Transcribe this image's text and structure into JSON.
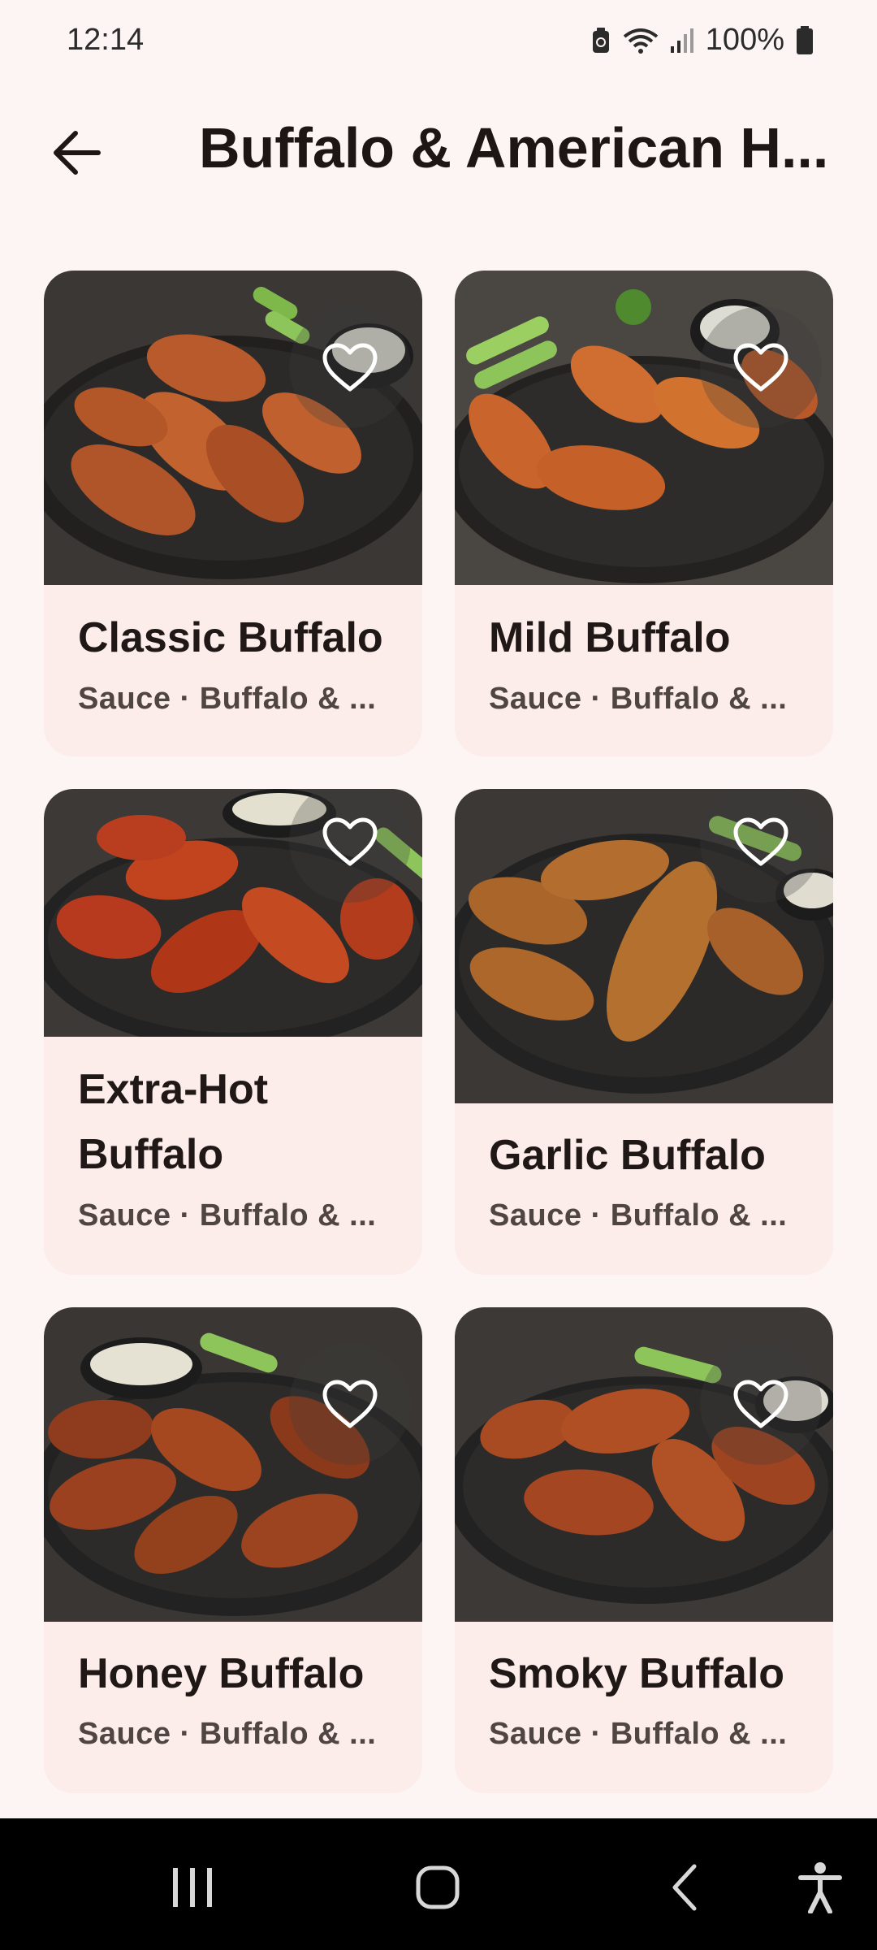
{
  "status": {
    "time": "12:14",
    "battery": "100%"
  },
  "header": {
    "title": "Buffalo & American H..."
  },
  "cards": [
    {
      "title": "Classic Buffalo",
      "subtitle": "Sauce · Buffalo & ..."
    },
    {
      "title": "Mild Buffalo",
      "subtitle": "Sauce · Buffalo & ..."
    },
    {
      "title": "Extra-Hot Buffalo",
      "subtitle": "Sauce · Buffalo & ..."
    },
    {
      "title": "Garlic Buffalo",
      "subtitle": "Sauce · Buffalo & ..."
    },
    {
      "title": "Honey Buffalo",
      "subtitle": "Sauce · Buffalo & ..."
    },
    {
      "title": "Smoky Buffalo",
      "subtitle": "Sauce · Buffalo & ..."
    }
  ],
  "icons": {
    "back": "arrow-left-icon",
    "favorite": "heart-outline-icon",
    "nav_recents": "recents-icon",
    "nav_home": "home-icon",
    "nav_back": "back-chevron-icon",
    "accessibility": "accessibility-icon"
  },
  "colors": {
    "background": "#fdf5f3",
    "card": "#fcecea",
    "nav": "#000000"
  }
}
